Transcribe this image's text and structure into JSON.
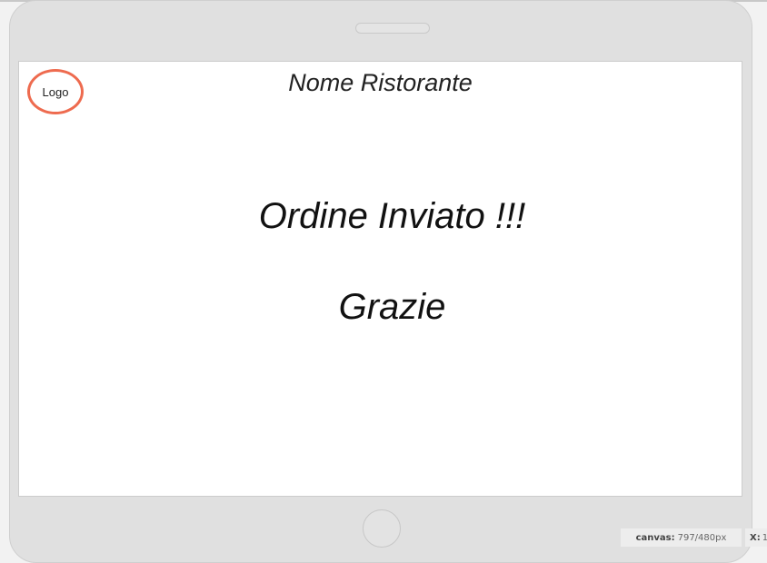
{
  "header": {
    "logo_label": "Logo",
    "restaurant_name": "Nome Ristorante"
  },
  "main": {
    "message": "Ordine Inviato !!!",
    "thanks": "Grazie"
  },
  "status_bar": {
    "canvas_label": "canvas:",
    "canvas_value": "797/480px",
    "x_label": "X:",
    "x_value": "1"
  },
  "colors": {
    "logo_border": "#ee6b4f",
    "device_frame": "#e0e0e0",
    "screen_background": "#ffffff"
  }
}
